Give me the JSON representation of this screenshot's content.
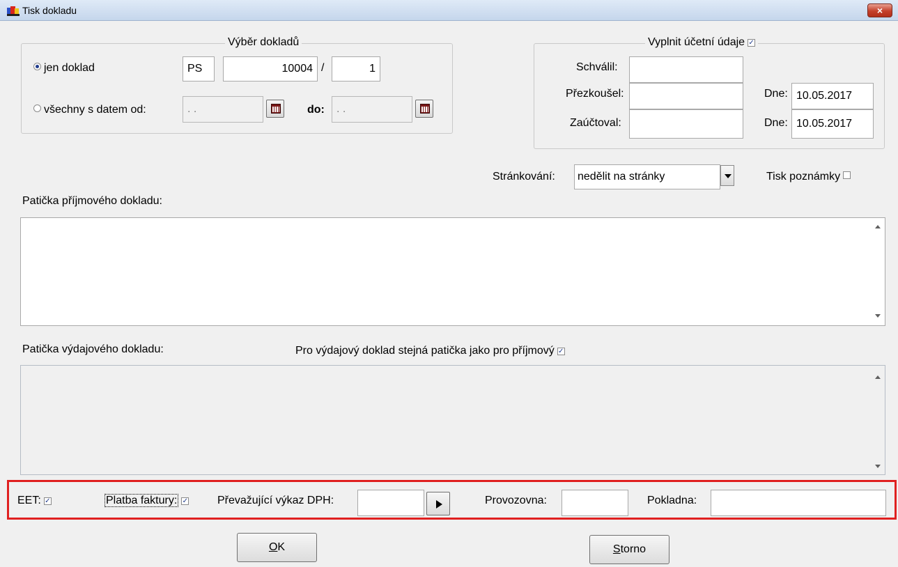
{
  "window": {
    "title": "Tisk dokladu",
    "close_symbol": "×"
  },
  "selection": {
    "title": "Výběr dokladů",
    "radio_single": "jen doklad",
    "doc_type": "PS",
    "doc_number": "10004",
    "separator": "/",
    "doc_sub": "1",
    "radio_range": "všechny s datem od:",
    "date_from": " .  .",
    "date_to_label": "do:",
    "date_to": " .  ."
  },
  "accounting": {
    "title": "Vyplnit účetní údaje",
    "approved_label": "Schválil:",
    "approved_value": "",
    "reviewed_label": "Přezkoušel:",
    "reviewed_value": "",
    "reviewed_date_label": "Dne:",
    "reviewed_date": "10.05.2017",
    "posted_label": "Zaúčtoval:",
    "posted_value": "",
    "posted_date_label": "Dne:",
    "posted_date": "10.05.2017"
  },
  "paging": {
    "label": "Stránkování:",
    "value": "nedělit na stránky"
  },
  "print_note": {
    "label": "Tisk poznámky"
  },
  "income_footer": {
    "label": "Patička příjmového dokladu:"
  },
  "expense_footer": {
    "label": "Patička výdajového dokladu:",
    "same_label": "Pro výdajový doklad stejná patička jako pro příjmový"
  },
  "bottom_bar": {
    "eet_label": "EET:",
    "invoice_payment_label": "Platba faktury:",
    "vat_label": "Převažující výkaz DPH:",
    "vat_value": "",
    "establishment_label": "Provozovna:",
    "establishment_value": "",
    "register_label": "Pokladna:",
    "register_value": ""
  },
  "buttons": {
    "ok_key": "O",
    "ok_rest": "K",
    "cancel_key": "S",
    "cancel_rest": "torno"
  },
  "check_mark": "✓"
}
